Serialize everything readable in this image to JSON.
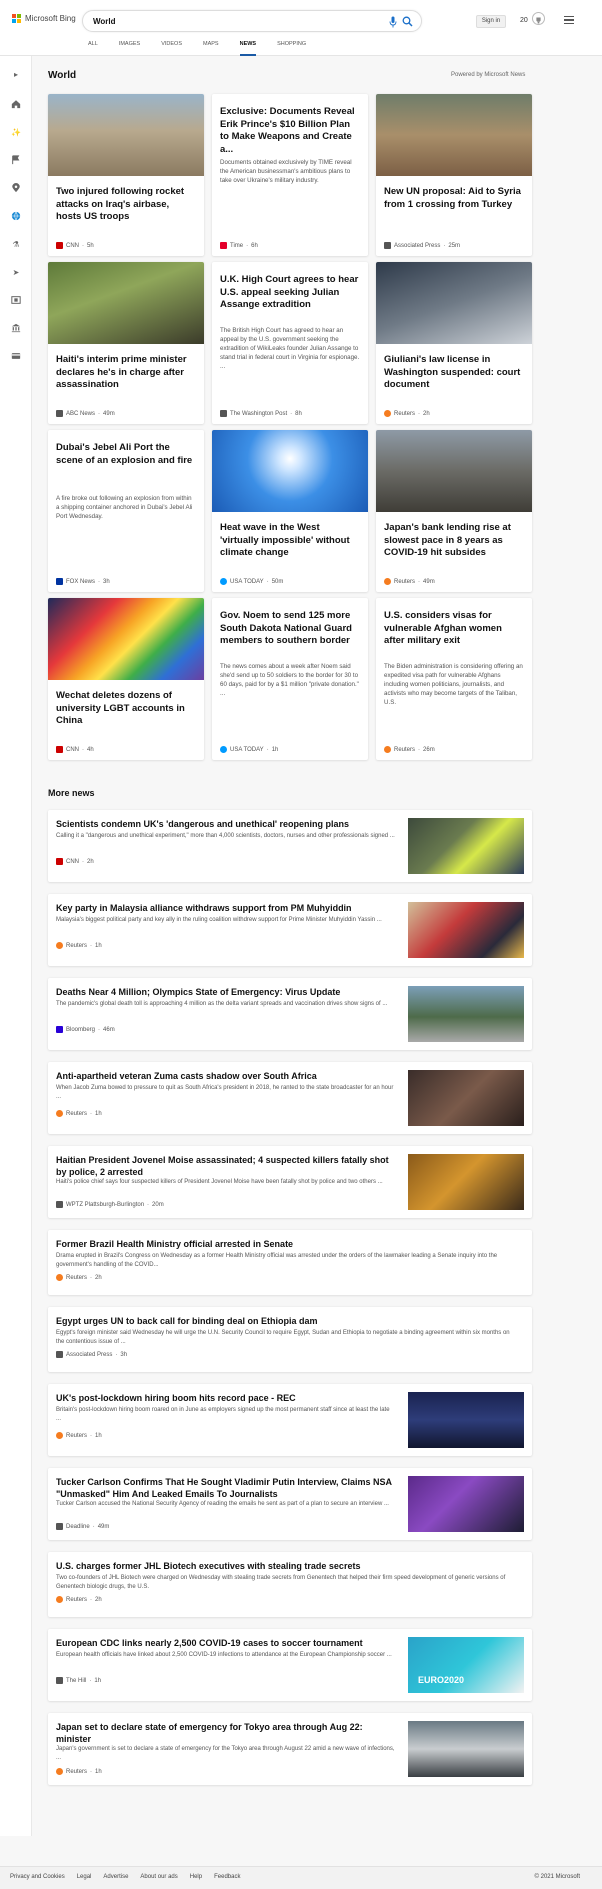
{
  "header": {
    "logo_text": "Microsoft Bing",
    "search_value": "World",
    "signin_label": "Sign in",
    "rewards_count": "20",
    "tabs": [
      "ALL",
      "IMAGES",
      "VIDEOS",
      "MAPS",
      "NEWS",
      "SHOPPING"
    ],
    "active_tab": "NEWS"
  },
  "section": {
    "title": "World",
    "powered_by": "Powered by Microsoft News"
  },
  "cards": [
    {
      "title": "Two injured following rocket attacks on Iraq's airbase, hosts US troops",
      "snippet": "",
      "source": "CNN",
      "time": "5h",
      "has_image": true
    },
    {
      "title": "Exclusive: Documents Reveal Erik Prince's $10 Billion Plan to Make Weapons and Create a...",
      "snippet": "Documents obtained exclusively by TIME reveal the American businessman's ambitious plans to take over Ukraine's military industry.",
      "source": "Time",
      "time": "6h",
      "has_image": false
    },
    {
      "title": "New UN proposal: Aid to Syria from 1 crossing from Turkey",
      "snippet": "",
      "source": "Associated Press",
      "time": "25m",
      "has_image": true
    },
    {
      "title": "Haiti's interim prime minister declares he's in charge after assassination",
      "snippet": "",
      "source": "ABC News",
      "time": "49m",
      "has_image": true
    },
    {
      "title": "U.K. High Court agrees to hear U.S. appeal seeking Julian Assange extradition",
      "snippet": "The British High Court has agreed to hear an appeal by the U.S. government seeking the extradition of WikiLeaks founder Julian Assange to stand trial in federal court in Virginia for espionage. ...",
      "source": "The Washington Post",
      "time": "8h",
      "has_image": false
    },
    {
      "title": "Giuliani's law license in Washington suspended: court document",
      "snippet": "",
      "source": "Reuters",
      "time": "2h",
      "has_image": true
    },
    {
      "title": "Dubai's Jebel Ali Port the scene of an explosion and fire",
      "snippet": "A fire broke out following an explosion from within a shipping container anchored in Dubai's Jebel Ali Port Wednesday.",
      "source": "FOX News",
      "time": "3h",
      "has_image": false
    },
    {
      "title": "Heat wave in the West 'virtually impossible' without climate change",
      "snippet": "",
      "source": "USA TODAY",
      "time": "50m",
      "has_image": true
    },
    {
      "title": "Japan's bank lending rise at slowest pace in 8 years as COVID-19 hit subsides",
      "snippet": "",
      "source": "Reuters",
      "time": "49m",
      "has_image": true
    },
    {
      "title": "Wechat deletes dozens of university LGBT accounts in China",
      "snippet": "",
      "source": "CNN",
      "time": "4h",
      "has_image": true
    },
    {
      "title": "Gov. Noem to send 125 more South Dakota National Guard members to southern border",
      "snippet": "The news comes about a week after Noem said she'd send up to 50 soldiers to the border for 30 to 60 days, paid for by a $1 million \"private donation.\" ...",
      "source": "USA TODAY",
      "time": "1h",
      "has_image": false
    },
    {
      "title": "U.S. considers visas for vulnerable Afghan women after military exit",
      "snippet": "The Biden administration is considering offering an expedited visa path for vulnerable Afghans including women politicians, journalists, and activists who may become targets of the Taliban, U.S.",
      "source": "Reuters",
      "time": "26m",
      "has_image": false
    }
  ],
  "more_news": {
    "title": "More news",
    "items": [
      {
        "title": "Scientists condemn UK's 'dangerous and unethical' reopening plans",
        "snippet": "Calling it a \"dangerous and unethical experiment,\" more than 4,000 scientists, doctors, nurses and other professionals signed ...",
        "source": "CNN",
        "time": "2h",
        "has_image": true
      },
      {
        "title": "Key party in Malaysia alliance withdraws support from PM Muhyiddin",
        "snippet": "Malaysia's biggest political party and key ally in the ruling coalition withdrew support for Prime Minister Muhyiddin Yassin ...",
        "source": "Reuters",
        "time": "1h",
        "has_image": true
      },
      {
        "title": "Deaths Near 4 Million; Olympics State of Emergency: Virus Update",
        "snippet": "The pandemic's global death toll is approaching 4 million as the delta variant spreads and vaccination drives show signs of ...",
        "source": "Bloomberg",
        "time": "46m",
        "has_image": true
      },
      {
        "title": "Anti-apartheid veteran Zuma casts shadow over South Africa",
        "snippet": "When Jacob Zuma bowed to pressure to quit as South Africa's president in 2018, he ranted to the state broadcaster for an hour ...",
        "source": "Reuters",
        "time": "1h",
        "has_image": true
      },
      {
        "title": "Haitian President Jovenel Moise assassinated; 4 suspected killers fatally shot by police, 2 arrested",
        "snippet": "Haiti's police chief says four suspected killers of President Jovenel Moise have been fatally shot by police and two others ...",
        "source": "WPTZ Plattsburgh-Burlington",
        "time": "20m",
        "has_image": true
      },
      {
        "title": "Former Brazil Health Ministry official arrested in Senate",
        "snippet": "Drama erupted in Brazil's Congress on Wednesday as a former Health Ministry official was arrested under the orders of the lawmaker leading a Senate inquiry into the government's handling of the COVID...",
        "source": "Reuters",
        "time": "2h",
        "has_image": false
      },
      {
        "title": "Egypt urges UN to back call for binding deal on Ethiopia dam",
        "snippet": "Egypt's foreign minister said Wednesday he will urge the U.N. Security Council to require Egypt, Sudan and Ethiopia to negotiate a binding agreement within six months on the contentious issue of ...",
        "source": "Associated Press",
        "time": "3h",
        "has_image": false
      },
      {
        "title": "UK's post-lockdown hiring boom hits record pace - REC",
        "snippet": "Britain's post-lockdown hiring boom roared on in June as employers signed up the most permanent staff since at least the late ...",
        "source": "Reuters",
        "time": "1h",
        "has_image": true
      },
      {
        "title": "Tucker Carlson Confirms That He Sought Vladimir Putin Interview, Claims NSA \"Unmasked\" Him And Leaked Emails To Journalists",
        "snippet": "Tucker Carlson accused the National Security Agency of reading the emails he sent as part of a plan to secure an interview ...",
        "source": "Deadline",
        "time": "49m",
        "has_image": true
      },
      {
        "title": "U.S. charges former JHL Biotech executives with stealing trade secrets",
        "snippet": "Two co-founders of JHL Biotech were charged on Wednesday with stealing trade secrets from Genentech that helped their firm speed development of generic versions of Genentech biologic drugs, the U.S.",
        "source": "Reuters",
        "time": "2h",
        "has_image": false
      },
      {
        "title": "European CDC links nearly 2,500 COVID-19 cases to soccer tournament",
        "snippet": "European health officials have linked about 2,500 COVID-19 infections to attendance at the European Championship soccer ...",
        "source": "The Hill",
        "time": "1h",
        "has_image": true,
        "image_text": "EURO2020"
      },
      {
        "title": "Japan set to declare state of emergency for Tokyo area through Aug 22: minister",
        "snippet": "Japan's government is set to declare a state of emergency for the Tokyo area through August 22 amid a new wave of infections, ...",
        "source": "Reuters",
        "time": "1h",
        "has_image": true
      }
    ]
  },
  "footer": {
    "links": [
      "Privacy and Cookies",
      "Legal",
      "Advertise",
      "About our ads",
      "Help",
      "Feedback"
    ],
    "copyright": "© 2021 Microsoft"
  },
  "colors": {
    "accent": "#1a5aa5",
    "cnn": "#cc0000",
    "reuters": "#f57c1f",
    "time": "#e4002b",
    "fox": "#0033a0",
    "usatoday": "#009bff",
    "bloomberg": "#2800d7"
  }
}
